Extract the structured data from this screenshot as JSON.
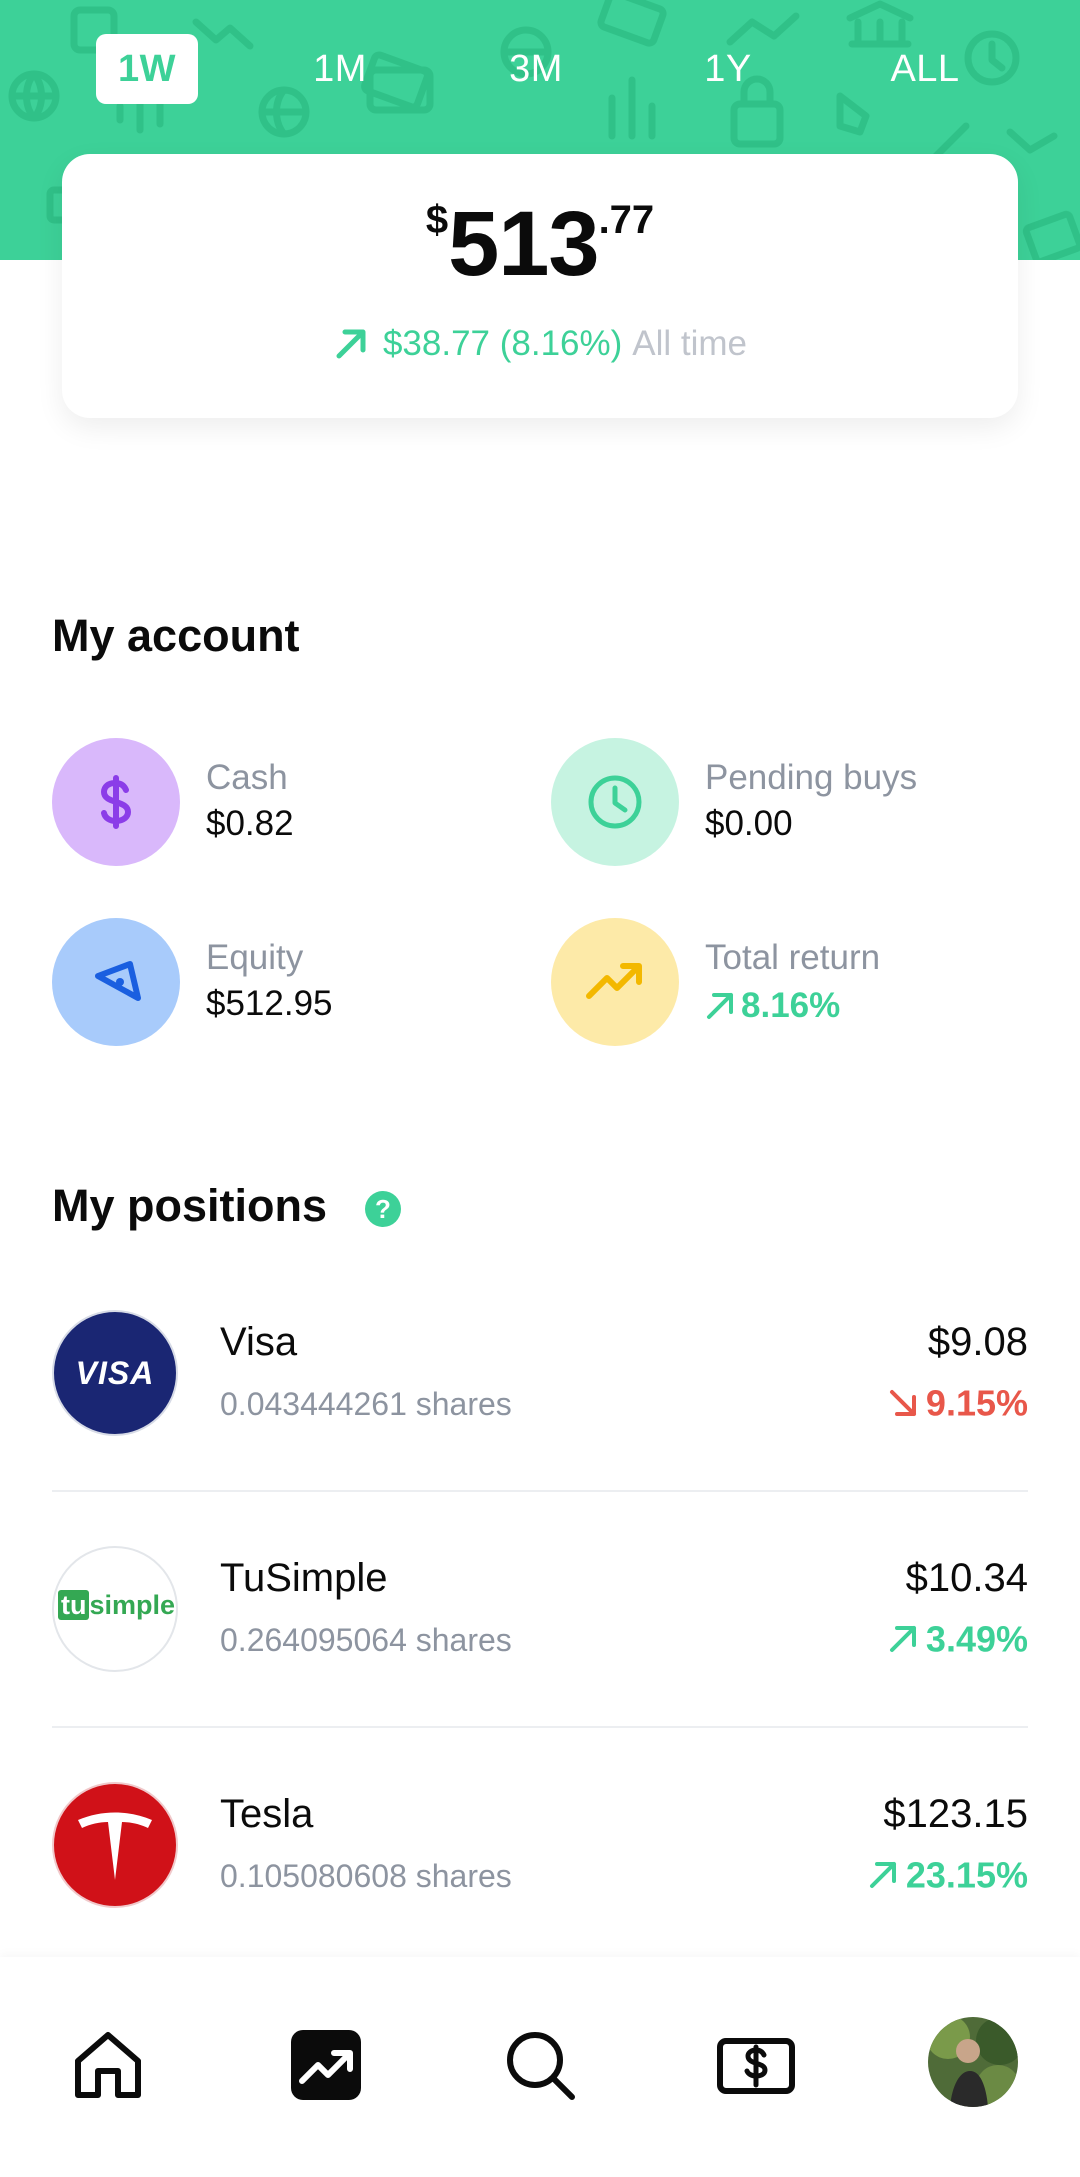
{
  "header": {
    "periods": [
      {
        "label": "1W",
        "active": true
      },
      {
        "label": "1M",
        "active": false
      },
      {
        "label": "3M",
        "active": false
      },
      {
        "label": "1Y",
        "active": false
      },
      {
        "label": "ALL",
        "active": false
      }
    ],
    "accent_color": "#3dd198"
  },
  "balance": {
    "currency": "$",
    "integer": "513",
    "decimal": ".77",
    "gain": "$38.77 (8.16%)",
    "gain_period": "All time",
    "gain_direction": "up"
  },
  "account": {
    "title": "My account",
    "stats": [
      {
        "label": "Cash",
        "value": "$0.82",
        "icon": "dollar-icon",
        "color": "#d9b8fb"
      },
      {
        "label": "Pending buys",
        "value": "$0.00",
        "icon": "clock-icon",
        "color": "#c6f3e1"
      },
      {
        "label": "Equity",
        "value": "$512.95",
        "icon": "pie-slice-icon",
        "color": "#a8cbfb"
      },
      {
        "label": "Total return",
        "value": "8.16%",
        "icon": "trend-up-icon",
        "color": "#fdeaa8"
      }
    ]
  },
  "positions": {
    "title": "My positions",
    "help_label": "?",
    "items": [
      {
        "name": "Visa",
        "shares": "0.043444261 shares",
        "price": "$9.08",
        "change": "9.15%",
        "direction": "down",
        "logo_text": "VISA"
      },
      {
        "name": "TuSimple",
        "shares": "0.264095064 shares",
        "price": "$10.34",
        "change": "3.49%",
        "direction": "up",
        "logo_text_a": "tu",
        "logo_text_b": "simple"
      },
      {
        "name": "Tesla",
        "shares": "0.105080608 shares",
        "price": "$123.15",
        "change": "23.15%",
        "direction": "up"
      }
    ]
  },
  "tabbar": {
    "items": [
      "home-icon",
      "portfolio-icon",
      "search-icon",
      "cash-icon",
      "profile-avatar"
    ]
  },
  "colors": {
    "up": "#3dd198",
    "down": "#e8574a"
  }
}
